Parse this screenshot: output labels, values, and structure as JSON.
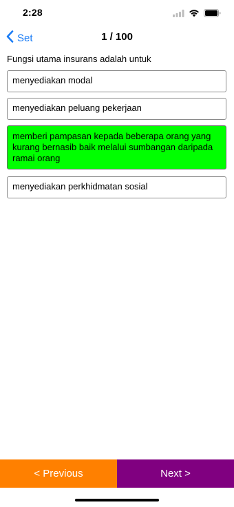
{
  "status": {
    "time": "2:28",
    "icons": [
      "cellular-icon",
      "wifi-icon",
      "battery-icon"
    ]
  },
  "nav": {
    "back_label": "Set",
    "title": "1 / 100"
  },
  "question": "Fungsi utama insurans adalah untuk",
  "options": [
    {
      "text": "menyediakan modal",
      "selected": false
    },
    {
      "text": "menyediakan peluang pekerjaan",
      "selected": false
    },
    {
      "text": "memberi pampasan kepada beberapa orang yang kurang bernasib baik melalui sumbangan daripada ramai orang",
      "selected": true
    },
    {
      "text": "menyediakan perkhidmatan sosial",
      "selected": false
    }
  ],
  "footer": {
    "prev_label": "< Previous",
    "next_label": "Next >"
  },
  "colors": {
    "accent": "#1a7cf5",
    "selected_option": "#00ff00",
    "prev_button": "#ff8000",
    "next_button": "#800080"
  }
}
